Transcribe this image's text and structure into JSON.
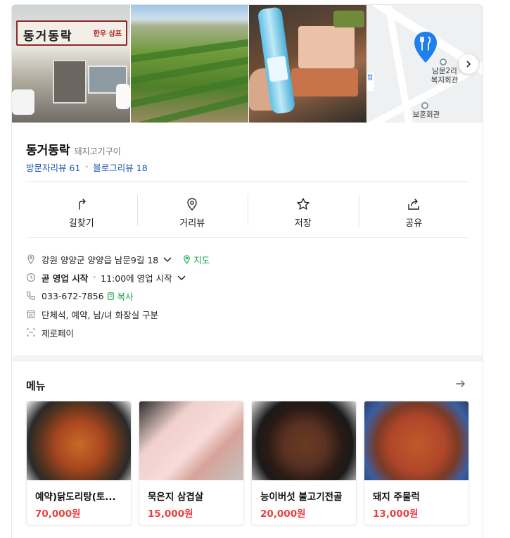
{
  "place": {
    "name": "동거동락",
    "category": "돼지고기구이",
    "visitor_reviews": "방문자리뷰 61",
    "blog_reviews": "블로그리뷰 18"
  },
  "photos": {
    "shop_sign": "동거동락",
    "shop_sign_sub": "한우 삼프",
    "map_labels": [
      "남문2리\n복지회관",
      "보훈회관"
    ],
    "map_side_text": "합"
  },
  "actions": [
    {
      "label": "길찾기",
      "icon": "directions-icon"
    },
    {
      "label": "거리뷰",
      "icon": "street-view-icon"
    },
    {
      "label": "저장",
      "icon": "star-icon"
    },
    {
      "label": "공유",
      "icon": "share-icon"
    }
  ],
  "info": {
    "address": "강원 양양군 양양읍 남문9길 18",
    "map_link": "지도",
    "hours_status": "곧 영업 시작",
    "hours_detail": "11:00에 영업 시작",
    "phone": "033-672-7856",
    "copy_link": "복사",
    "amenities": "단체석, 예약, 남/녀 화장실 구분",
    "payment": "제로페이"
  },
  "menu": {
    "title": "메뉴",
    "items": [
      {
        "name": "예약)닭도리탕(토...",
        "price": "70,000원"
      },
      {
        "name": "묵은지 삼겹살",
        "price": "15,000원"
      },
      {
        "name": "능이버섯 불고기전골",
        "price": "20,000원"
      },
      {
        "name": "돼지 주물럭",
        "price": "13,000원"
      }
    ]
  },
  "colors": {
    "link_blue": "#1a55b4",
    "accent_green": "#15a34a",
    "price_red": "#e8423f",
    "map_pin": "#1f7ef0"
  }
}
